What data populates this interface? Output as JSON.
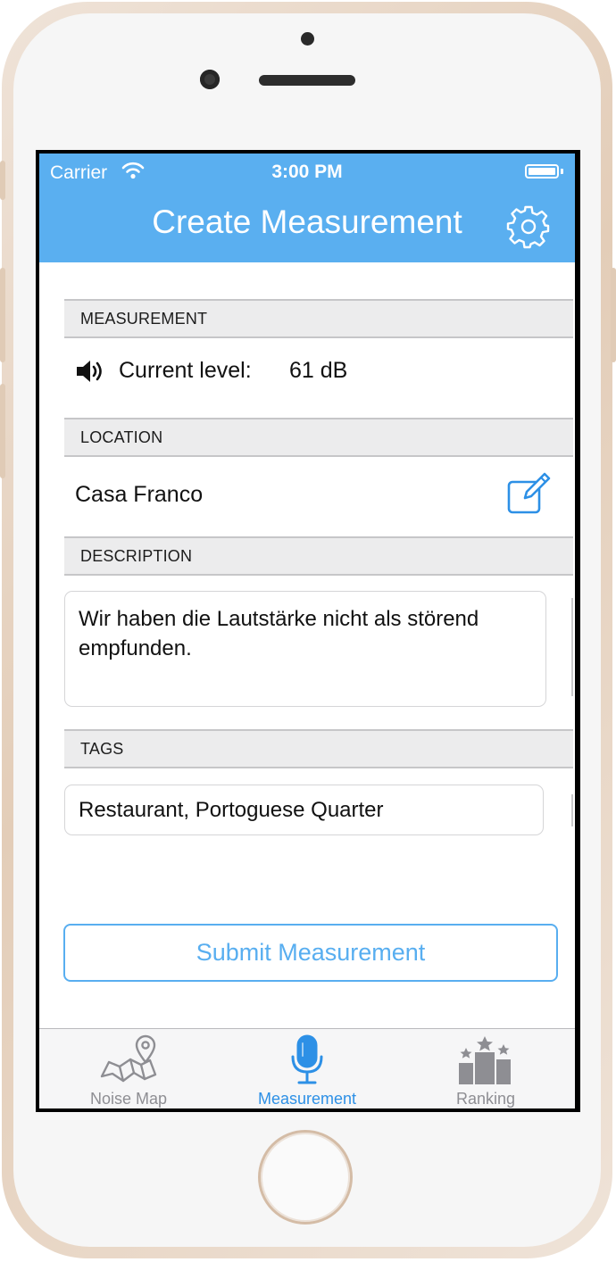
{
  "status_bar": {
    "carrier": "Carrier",
    "time": "3:00 PM"
  },
  "nav": {
    "title": "Create Measurement",
    "settings_icon": "gear-icon"
  },
  "measurement": {
    "header": "MEASUREMENT",
    "label": "Current level:",
    "value": "61 dB",
    "icon": "speaker-icon"
  },
  "location": {
    "header": "LOCATION",
    "name": "Casa Franco",
    "edit_icon": "edit-icon"
  },
  "description": {
    "header": "DESCRIPTION",
    "value": "Wir haben die Lautstärke nicht als störend empfunden."
  },
  "tags": {
    "header": "TAGS",
    "value": "Restaurant, Portoguese Quarter"
  },
  "submit": {
    "label": "Submit Measurement"
  },
  "tabs": [
    {
      "label": "Noise Map",
      "icon": "map-pin-icon",
      "active": false
    },
    {
      "label": "Measurement",
      "icon": "microphone-icon",
      "active": true
    },
    {
      "label": "Ranking",
      "icon": "podium-icon",
      "active": false
    }
  ],
  "colors": {
    "accent": "#5aaff0",
    "tab_active": "#2d90e6",
    "tab_inactive": "#8e8e93",
    "section_bg": "#ececed"
  }
}
